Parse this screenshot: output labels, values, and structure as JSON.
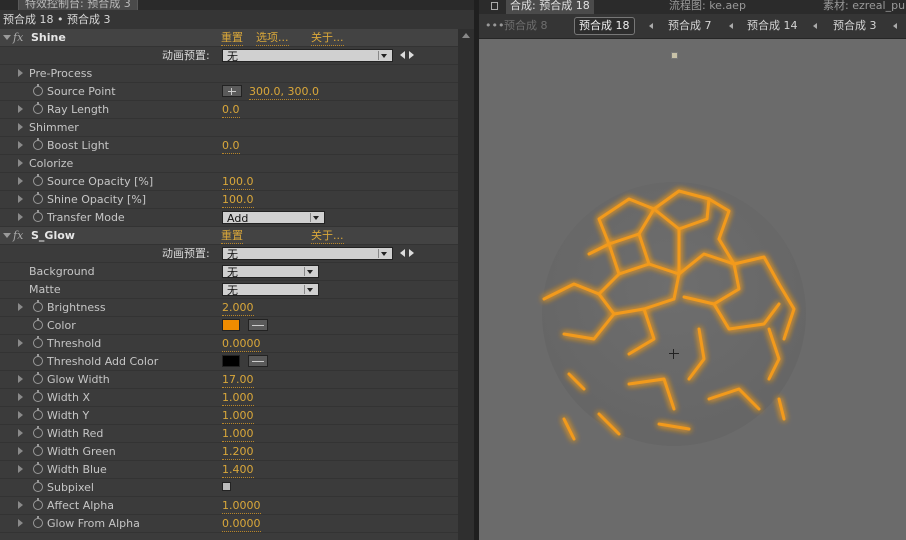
{
  "left_panel": {
    "tab_title": "特效控制台: 预合成 3",
    "breadcrumb": "预合成 18 • 预合成 3",
    "shine": {
      "name": "Shine",
      "reset": "重置",
      "options": "选项...",
      "about": "关于...",
      "preset_label": "动画预置:",
      "preset_value": "无",
      "props": {
        "pre_process": "Pre-Process",
        "source_point": "Source Point",
        "source_point_value": "300.0, 300.0",
        "ray_length": "Ray Length",
        "ray_length_value": "0.0",
        "shimmer": "Shimmer",
        "boost_light": "Boost Light",
        "boost_light_value": "0.0",
        "colorize": "Colorize",
        "source_opacity": "Source Opacity [%]",
        "source_opacity_value": "100.0",
        "shine_opacity": "Shine Opacity [%]",
        "shine_opacity_value": "100.0",
        "transfer_mode": "Transfer Mode",
        "transfer_mode_value": "Add"
      }
    },
    "glow": {
      "name": "S_Glow",
      "reset": "重置",
      "about": "关于...",
      "preset_label": "动画预置:",
      "preset_value": "无",
      "props": {
        "background": "Background",
        "background_value": "无",
        "matte": "Matte",
        "matte_value": "无",
        "brightness": "Brightness",
        "brightness_value": "2.000",
        "color": "Color",
        "color_hex": "#f08c00",
        "threshold": "Threshold",
        "threshold_value": "0.0000",
        "threshold_add_color": "Threshold Add Color",
        "threshold_add_color_hex": "#000000",
        "glow_width": "Glow Width",
        "glow_width_value": "17.00",
        "width_x": "Width X",
        "width_x_value": "1.000",
        "width_y": "Width Y",
        "width_y_value": "1.000",
        "width_red": "Width Red",
        "width_red_value": "1.000",
        "width_green": "Width Green",
        "width_green_value": "1.200",
        "width_blue": "Width Blue",
        "width_blue_value": "1.400",
        "subpixel": "Subpixel",
        "affect_alpha": "Affect Alpha",
        "affect_alpha_value": "1.0000",
        "glow_from_alpha": "Glow From Alpha",
        "glow_from_alpha_value": "0.0000"
      }
    }
  },
  "right_panel": {
    "tabs": {
      "comp": "合成: 预合成 18",
      "flowchart": "流程图: ke.aep",
      "footage": "素材: ezreal_pu"
    },
    "flow_items": {
      "first": "预合成 8",
      "active": "预合成 18",
      "second": "预合成 7",
      "third": "预合成 14",
      "fourth": "预合成 3"
    },
    "viewer_bg": "#6b6b6b",
    "glow_color": "#f29a1c"
  }
}
